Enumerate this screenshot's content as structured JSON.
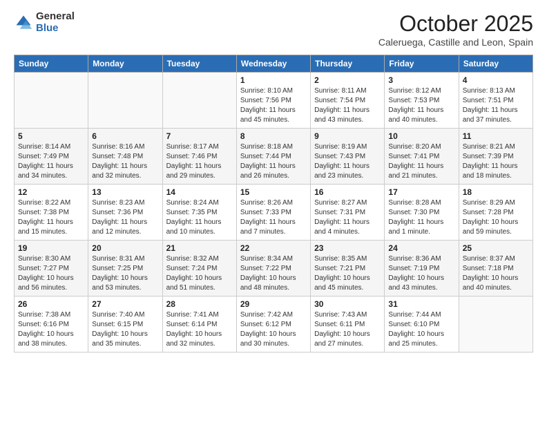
{
  "header": {
    "logo_general": "General",
    "logo_blue": "Blue",
    "month_title": "October 2025",
    "subtitle": "Caleruega, Castille and Leon, Spain"
  },
  "days_of_week": [
    "Sunday",
    "Monday",
    "Tuesday",
    "Wednesday",
    "Thursday",
    "Friday",
    "Saturday"
  ],
  "weeks": [
    [
      {
        "day": "",
        "content": ""
      },
      {
        "day": "",
        "content": ""
      },
      {
        "day": "",
        "content": ""
      },
      {
        "day": "1",
        "content": "Sunrise: 8:10 AM\nSunset: 7:56 PM\nDaylight: 11 hours and 45 minutes."
      },
      {
        "day": "2",
        "content": "Sunrise: 8:11 AM\nSunset: 7:54 PM\nDaylight: 11 hours and 43 minutes."
      },
      {
        "day": "3",
        "content": "Sunrise: 8:12 AM\nSunset: 7:53 PM\nDaylight: 11 hours and 40 minutes."
      },
      {
        "day": "4",
        "content": "Sunrise: 8:13 AM\nSunset: 7:51 PM\nDaylight: 11 hours and 37 minutes."
      }
    ],
    [
      {
        "day": "5",
        "content": "Sunrise: 8:14 AM\nSunset: 7:49 PM\nDaylight: 11 hours and 34 minutes."
      },
      {
        "day": "6",
        "content": "Sunrise: 8:16 AM\nSunset: 7:48 PM\nDaylight: 11 hours and 32 minutes."
      },
      {
        "day": "7",
        "content": "Sunrise: 8:17 AM\nSunset: 7:46 PM\nDaylight: 11 hours and 29 minutes."
      },
      {
        "day": "8",
        "content": "Sunrise: 8:18 AM\nSunset: 7:44 PM\nDaylight: 11 hours and 26 minutes."
      },
      {
        "day": "9",
        "content": "Sunrise: 8:19 AM\nSunset: 7:43 PM\nDaylight: 11 hours and 23 minutes."
      },
      {
        "day": "10",
        "content": "Sunrise: 8:20 AM\nSunset: 7:41 PM\nDaylight: 11 hours and 21 minutes."
      },
      {
        "day": "11",
        "content": "Sunrise: 8:21 AM\nSunset: 7:39 PM\nDaylight: 11 hours and 18 minutes."
      }
    ],
    [
      {
        "day": "12",
        "content": "Sunrise: 8:22 AM\nSunset: 7:38 PM\nDaylight: 11 hours and 15 minutes."
      },
      {
        "day": "13",
        "content": "Sunrise: 8:23 AM\nSunset: 7:36 PM\nDaylight: 11 hours and 12 minutes."
      },
      {
        "day": "14",
        "content": "Sunrise: 8:24 AM\nSunset: 7:35 PM\nDaylight: 11 hours and 10 minutes."
      },
      {
        "day": "15",
        "content": "Sunrise: 8:26 AM\nSunset: 7:33 PM\nDaylight: 11 hours and 7 minutes."
      },
      {
        "day": "16",
        "content": "Sunrise: 8:27 AM\nSunset: 7:31 PM\nDaylight: 11 hours and 4 minutes."
      },
      {
        "day": "17",
        "content": "Sunrise: 8:28 AM\nSunset: 7:30 PM\nDaylight: 11 hours and 1 minute."
      },
      {
        "day": "18",
        "content": "Sunrise: 8:29 AM\nSunset: 7:28 PM\nDaylight: 10 hours and 59 minutes."
      }
    ],
    [
      {
        "day": "19",
        "content": "Sunrise: 8:30 AM\nSunset: 7:27 PM\nDaylight: 10 hours and 56 minutes."
      },
      {
        "day": "20",
        "content": "Sunrise: 8:31 AM\nSunset: 7:25 PM\nDaylight: 10 hours and 53 minutes."
      },
      {
        "day": "21",
        "content": "Sunrise: 8:32 AM\nSunset: 7:24 PM\nDaylight: 10 hours and 51 minutes."
      },
      {
        "day": "22",
        "content": "Sunrise: 8:34 AM\nSunset: 7:22 PM\nDaylight: 10 hours and 48 minutes."
      },
      {
        "day": "23",
        "content": "Sunrise: 8:35 AM\nSunset: 7:21 PM\nDaylight: 10 hours and 45 minutes."
      },
      {
        "day": "24",
        "content": "Sunrise: 8:36 AM\nSunset: 7:19 PM\nDaylight: 10 hours and 43 minutes."
      },
      {
        "day": "25",
        "content": "Sunrise: 8:37 AM\nSunset: 7:18 PM\nDaylight: 10 hours and 40 minutes."
      }
    ],
    [
      {
        "day": "26",
        "content": "Sunrise: 7:38 AM\nSunset: 6:16 PM\nDaylight: 10 hours and 38 minutes."
      },
      {
        "day": "27",
        "content": "Sunrise: 7:40 AM\nSunset: 6:15 PM\nDaylight: 10 hours and 35 minutes."
      },
      {
        "day": "28",
        "content": "Sunrise: 7:41 AM\nSunset: 6:14 PM\nDaylight: 10 hours and 32 minutes."
      },
      {
        "day": "29",
        "content": "Sunrise: 7:42 AM\nSunset: 6:12 PM\nDaylight: 10 hours and 30 minutes."
      },
      {
        "day": "30",
        "content": "Sunrise: 7:43 AM\nSunset: 6:11 PM\nDaylight: 10 hours and 27 minutes."
      },
      {
        "day": "31",
        "content": "Sunrise: 7:44 AM\nSunset: 6:10 PM\nDaylight: 10 hours and 25 minutes."
      },
      {
        "day": "",
        "content": ""
      }
    ]
  ]
}
